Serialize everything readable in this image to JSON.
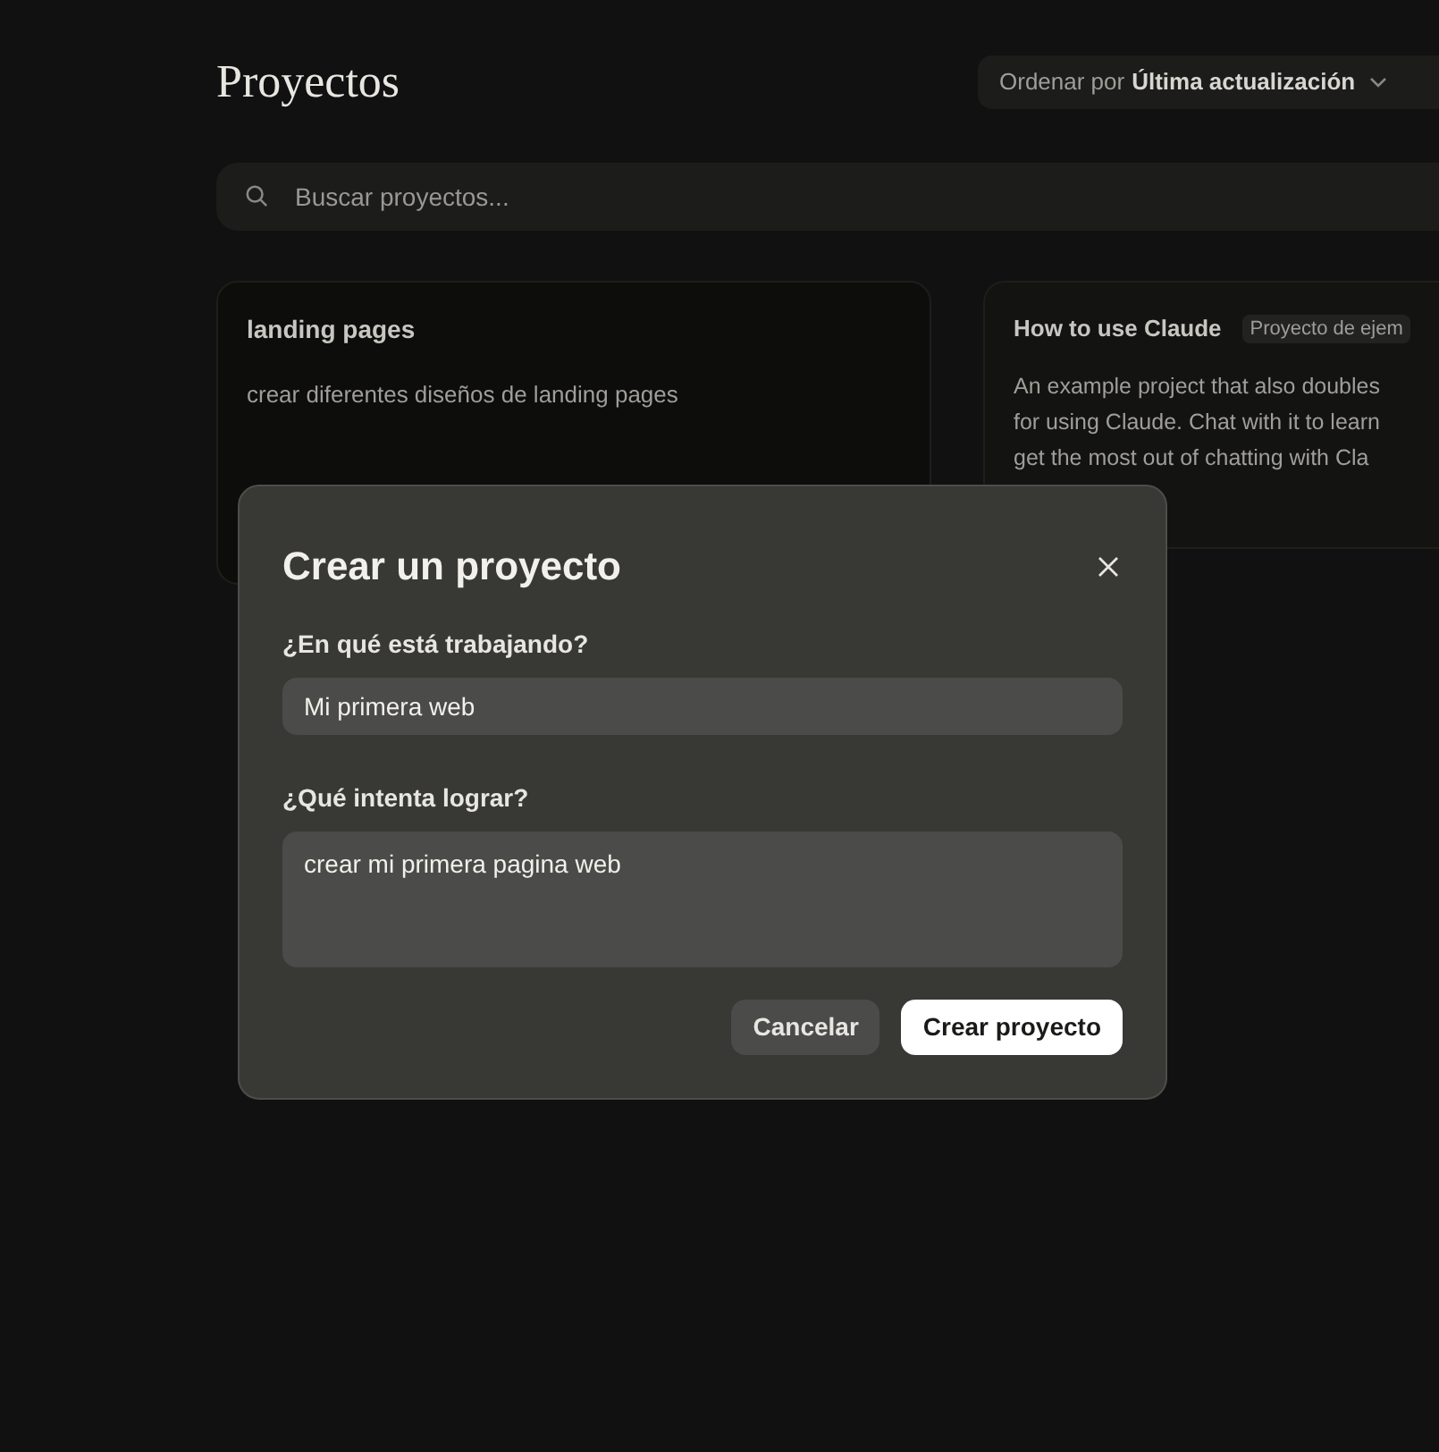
{
  "page": {
    "title": "Proyectos",
    "sort": {
      "label": "Ordenar por",
      "value": "Última actualización"
    },
    "search": {
      "placeholder": "Buscar proyectos..."
    },
    "projects": [
      {
        "name": "landing pages",
        "description": "crear diferentes diseños de landing pages"
      },
      {
        "name": "How to use Claude",
        "badge": "Proyecto de ejem",
        "description_lines": [
          "An example project that also doubles",
          "for using Claude. Chat with it to learn",
          "get the most out of chatting with Cla"
        ]
      }
    ]
  },
  "dialog": {
    "title": "Crear un proyecto",
    "fields": [
      {
        "kind": "input",
        "label": "¿En qué está trabajando?",
        "value": "Mi primera web"
      },
      {
        "kind": "textarea",
        "label": "¿Qué intenta lograr?",
        "value": "crear mi primera pagina web"
      }
    ],
    "buttons": [
      {
        "kind": "secondary",
        "label": "Cancelar"
      },
      {
        "kind": "primary",
        "label": "Crear proyecto"
      }
    ]
  }
}
